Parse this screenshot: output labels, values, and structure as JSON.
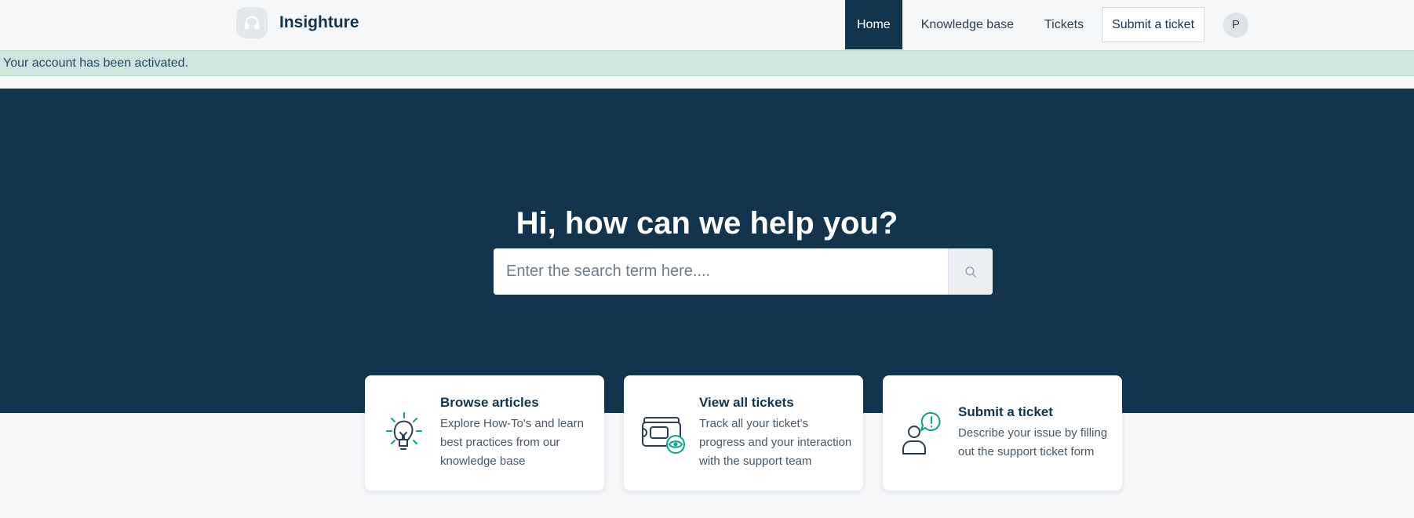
{
  "header": {
    "brand_name": "Insighture",
    "logo_icon": "headset-icon",
    "nav": {
      "home": "Home",
      "knowledge_base": "Knowledge base",
      "tickets": "Tickets",
      "submit_ticket": "Submit a ticket"
    },
    "avatar_initial": "P"
  },
  "alert": {
    "message": "Your account has been activated."
  },
  "hero": {
    "title": "Hi, how can we help you?",
    "search_placeholder": "Enter the search term here....",
    "search_icon": "search-icon"
  },
  "cards": [
    {
      "title": "Browse articles",
      "description": "Explore How-To's and learn best practices from our knowledge base",
      "icon": "lightbulb-icon"
    },
    {
      "title": "View all tickets",
      "description": "Track all your ticket's progress and your interaction with the support team",
      "icon": "tickets-eye-icon"
    },
    {
      "title": "Submit a ticket",
      "description": "Describe your issue by filling out the support ticket form",
      "icon": "user-alert-icon"
    }
  ],
  "colors": {
    "primary": "#12344d",
    "accent": "#00a886",
    "alert_bg": "#cde6de",
    "page_bg": "#f5f7f9"
  }
}
